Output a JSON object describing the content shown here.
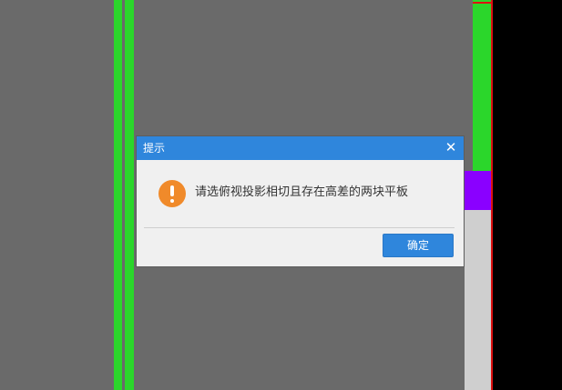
{
  "dialog": {
    "title": "提示",
    "close_icon": "close-icon",
    "message": "请选俯视投影相切且存在高差的两块平板",
    "status_icon": "warning-icon",
    "ok_label": "确定"
  },
  "colors": {
    "titlebar": "#2f86dc",
    "button": "#2f86dc",
    "warning": "#f08a2a",
    "green": "#2bd62b",
    "purple": "#8a00ff",
    "background": "#6a6a6a"
  }
}
